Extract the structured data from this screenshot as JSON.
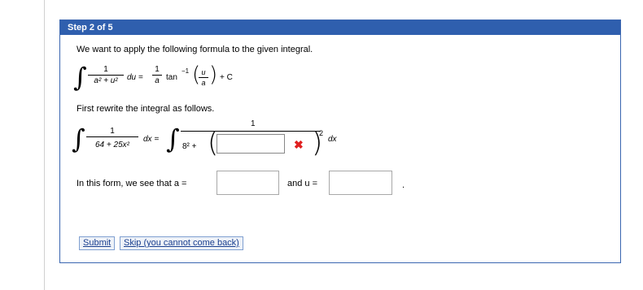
{
  "step": {
    "label": "Step 2 of 5"
  },
  "intro": "We want to apply the following formula to the given integral.",
  "formula": {
    "integral_sign": "∫",
    "num": "1",
    "den": "a² + u²",
    "du": "du =",
    "coef_num": "1",
    "coef_den": "a",
    "func": "tan",
    "exp": "−1",
    "arg_num": "u",
    "arg_den": "a",
    "plus_c": "+ C"
  },
  "rewrite": {
    "label": "First rewrite the integral as follows.",
    "integral_sign": "∫",
    "num": "1",
    "den": "64 + 25x²",
    "dx": "dx =",
    "rhs_num": "1",
    "rhs_den_prefix": "8² +",
    "rhs_exp": "2",
    "rhs_dx": "dx",
    "input_value": "",
    "input_status": "incorrect"
  },
  "form": {
    "label_a": "In this form, we see that a =",
    "a_value": "",
    "label_u": "and u =",
    "u_value": "",
    "period": "."
  },
  "buttons": {
    "submit": "Submit",
    "skip": "Skip (you cannot come back)"
  },
  "colors": {
    "header_bg": "#2f5fae",
    "error": "#e02020"
  }
}
